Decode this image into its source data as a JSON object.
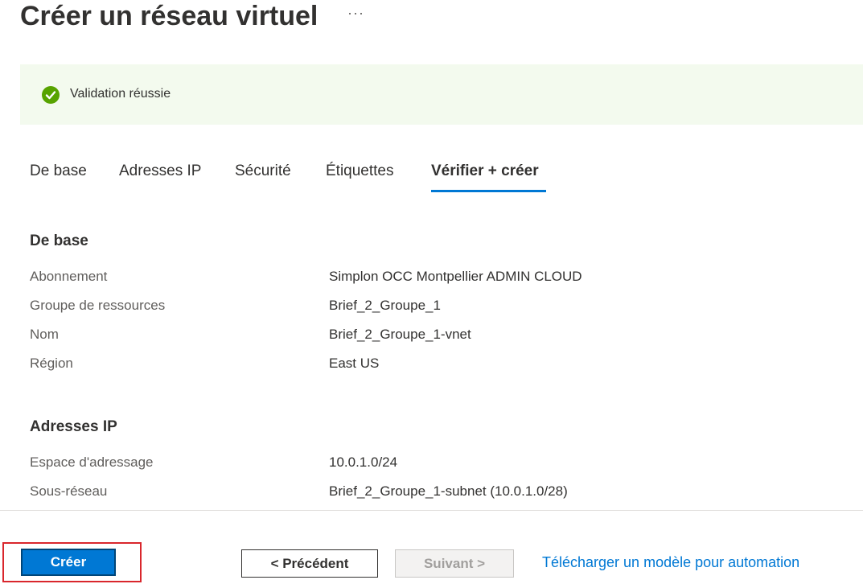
{
  "header": {
    "title": "Créer un réseau virtuel",
    "more_label": "···"
  },
  "banner": {
    "icon": "check-circle-icon",
    "message": "Validation réussie",
    "status_color": "#57a300"
  },
  "tabs": [
    {
      "label": "De base",
      "active": false
    },
    {
      "label": "Adresses IP",
      "active": false
    },
    {
      "label": "Sécurité",
      "active": false
    },
    {
      "label": "Étiquettes",
      "active": false
    },
    {
      "label": "Vérifier + créer",
      "active": true
    }
  ],
  "sections": [
    {
      "heading": "De base",
      "rows": [
        {
          "label": "Abonnement",
          "value": "Simplon OCC Montpellier ADMIN CLOUD"
        },
        {
          "label": "Groupe de ressources",
          "value": "Brief_2_Groupe_1"
        },
        {
          "label": "Nom",
          "value": "Brief_2_Groupe_1-vnet"
        },
        {
          "label": "Région",
          "value": "East US"
        }
      ]
    },
    {
      "heading": "Adresses IP",
      "rows": [
        {
          "label": "Espace d'adressage",
          "value": "10.0.1.0/24"
        },
        {
          "label": "Sous-réseau",
          "value": "Brief_2_Groupe_1-subnet (10.0.1.0/28)"
        }
      ]
    }
  ],
  "footer": {
    "create_label": "Créer",
    "previous_label": "< Précédent",
    "next_label": "Suivant >",
    "download_link": "Télécharger un modèle pour automation"
  },
  "colors": {
    "accent": "#0078d4",
    "highlight": "#d9262c",
    "banner_bg": "#f3faee"
  }
}
